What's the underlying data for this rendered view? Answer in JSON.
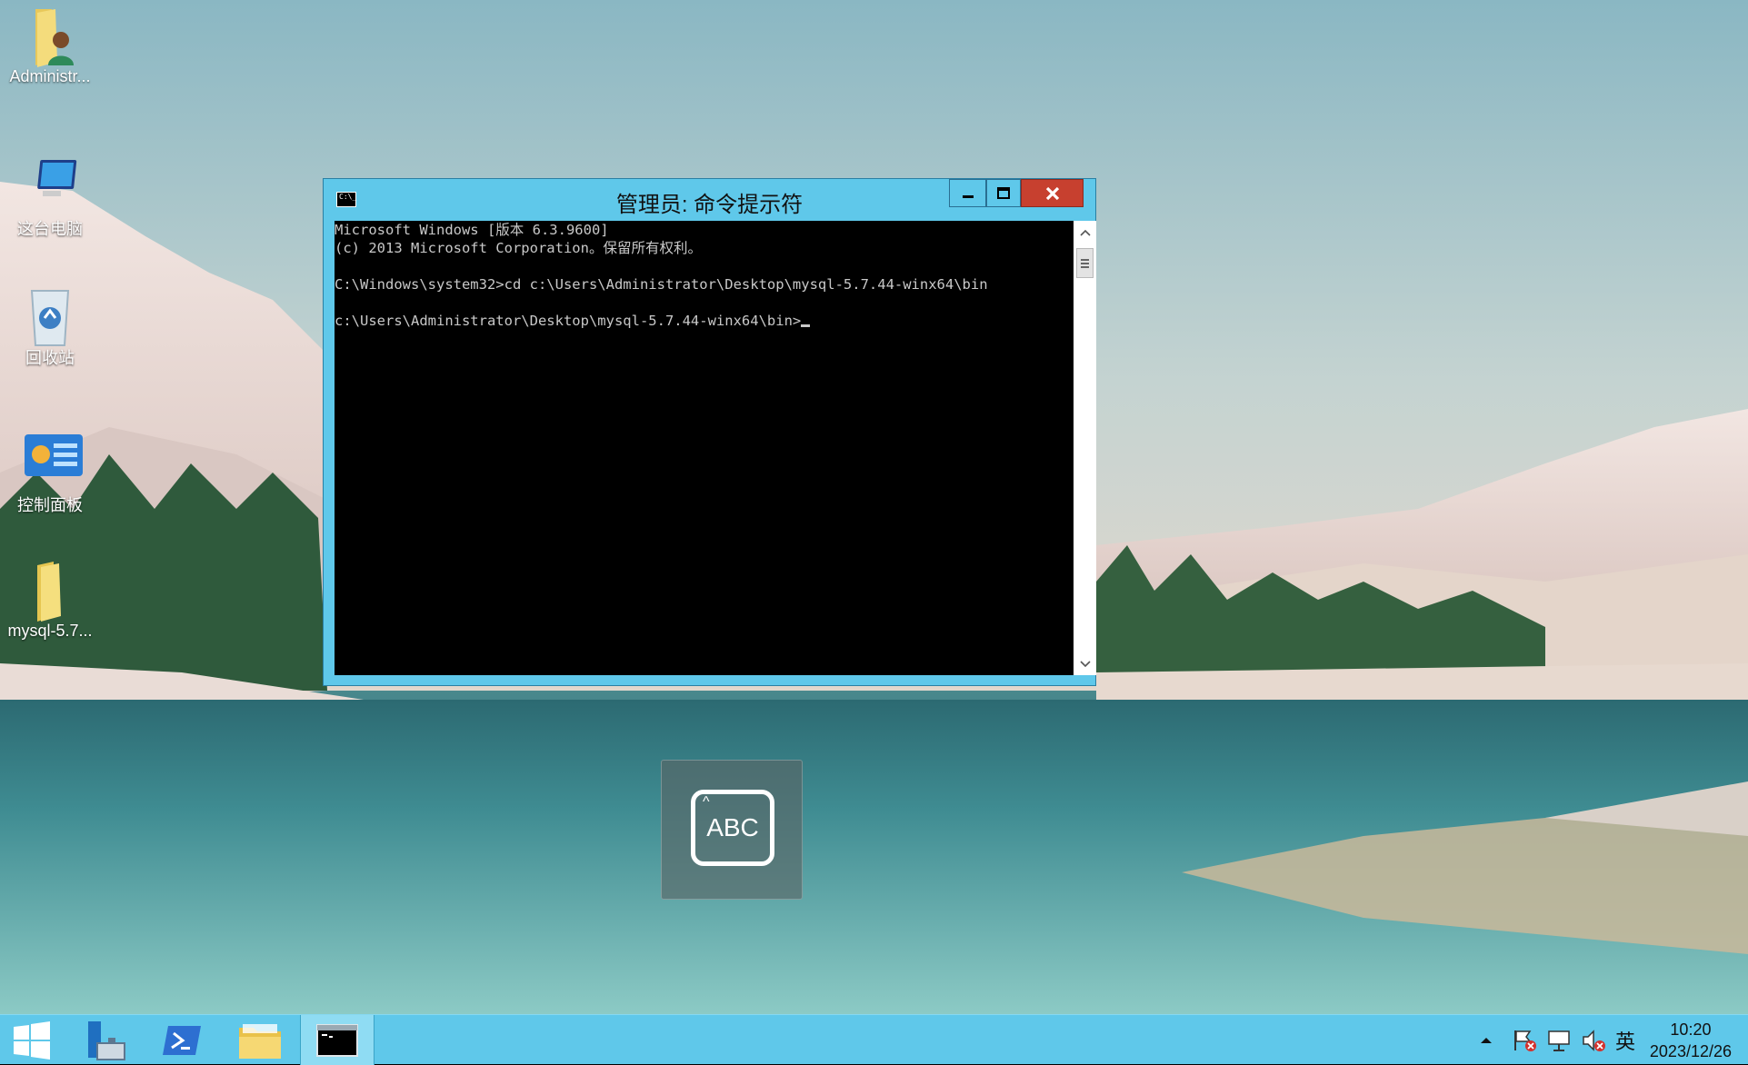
{
  "desktop": {
    "icons": [
      {
        "label": "Administr..."
      },
      {
        "label": "这台电脑"
      },
      {
        "label": "回收站"
      },
      {
        "label": "控制面板"
      },
      {
        "label": "mysql-5.7..."
      }
    ]
  },
  "cmd_window": {
    "title": "管理员: 命令提示符",
    "sys_icon_text": "C:\\_",
    "lines": [
      "Microsoft Windows [版本 6.3.9600]",
      "(c) 2013 Microsoft Corporation。保留所有权利。",
      "",
      "C:\\Windows\\system32>cd c:\\Users\\Administrator\\Desktop\\mysql-5.7.44-winx64\\bin",
      "",
      "c:\\Users\\Administrator\\Desktop\\mysql-5.7.44-winx64\\bin>"
    ]
  },
  "ime": {
    "label": "ABC"
  },
  "taskbar": {
    "apps": [
      "start-icon",
      "server-manager-icon",
      "powershell-icon",
      "file-explorer-icon",
      "command-prompt-icon"
    ],
    "tray": {
      "input_language": "英",
      "time": "10:20",
      "date": "2023/12/26"
    }
  },
  "colors": {
    "chrome": "#5fc8ea",
    "close": "#c7402f",
    "console_bg": "#000000",
    "console_fg": "#c8c8c8"
  }
}
